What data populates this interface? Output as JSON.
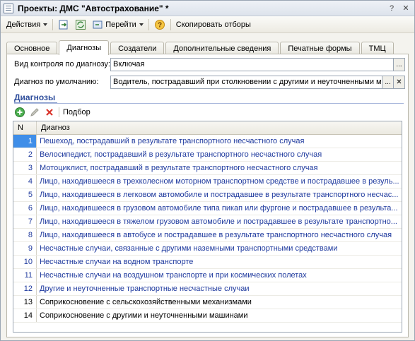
{
  "window": {
    "title": "Проекты: ДМС \"Автострахование\" *"
  },
  "toolbar": {
    "actions_label": "Действия",
    "goto_label": "Перейти",
    "copy_filters_label": "Скопировать отборы"
  },
  "tabs": [
    {
      "label": "Основное"
    },
    {
      "label": "Диагнозы"
    },
    {
      "label": "Создатели"
    },
    {
      "label": "Дополнительные сведения"
    },
    {
      "label": "Печатные формы"
    },
    {
      "label": "ТМЦ"
    }
  ],
  "form": {
    "control_type_label": "Вид контроля по диагнозу:",
    "control_type_value": "Включая",
    "default_diag_label": "Диагноз по умолчанию:",
    "default_diag_value": "Водитель, пострадавший при столкновении с другими и неуточненными м"
  },
  "diagnoses": {
    "section_title": "Диагнозы",
    "pick_label": "Подбор",
    "columns": {
      "n": "N",
      "diag": "Диагноз"
    },
    "rows": [
      {
        "n": "1",
        "text": "Пешеход, пострадавший в результате транспортного несчастного случая"
      },
      {
        "n": "2",
        "text": "Велосипедист, пострадавший в результате транспортного несчастного случая"
      },
      {
        "n": "3",
        "text": "Мотоциклист, пострадавший в результате транспортного несчастного случая"
      },
      {
        "n": "4",
        "text": "Лицо, находившееся в трехколесном моторном транспортном средстве и пострадавшее в резуль..."
      },
      {
        "n": "5",
        "text": "Лицо, находившееся в легковом автомобиле и пострадавшее в результате транспортного несчас..."
      },
      {
        "n": "6",
        "text": "Лицо, находившееся в грузовом автомобиле типа пикап или фургоне и пострадавшее в результа..."
      },
      {
        "n": "7",
        "text": "Лицо, находившееся в тяжелом грузовом автомобиле и пострадавшее в результате транспортно..."
      },
      {
        "n": "8",
        "text": "Лицо, находившееся в автобусе и пострадавшее в результате транспортного несчастного случая"
      },
      {
        "n": "9",
        "text": "Несчастные случаи, связанные с другими наземными транспортными средствами"
      },
      {
        "n": "10",
        "text": "Несчастные случаи на водном транспорте"
      },
      {
        "n": "11",
        "text": "Несчастные случаи на воздушном транспорте и при космических полетах"
      },
      {
        "n": "12",
        "text": "Другие и неуточненные транспортные несчастные случаи"
      },
      {
        "n": "13",
        "text": "Соприкосновение с сельскохозяйственными механизмами"
      },
      {
        "n": "14",
        "text": "Соприкосновение с другими и неуточненными машинами"
      }
    ]
  },
  "colors": {
    "accent": "#2f4e9c",
    "link_text": "#1f3a9e",
    "selection": "#3f8ee8"
  }
}
